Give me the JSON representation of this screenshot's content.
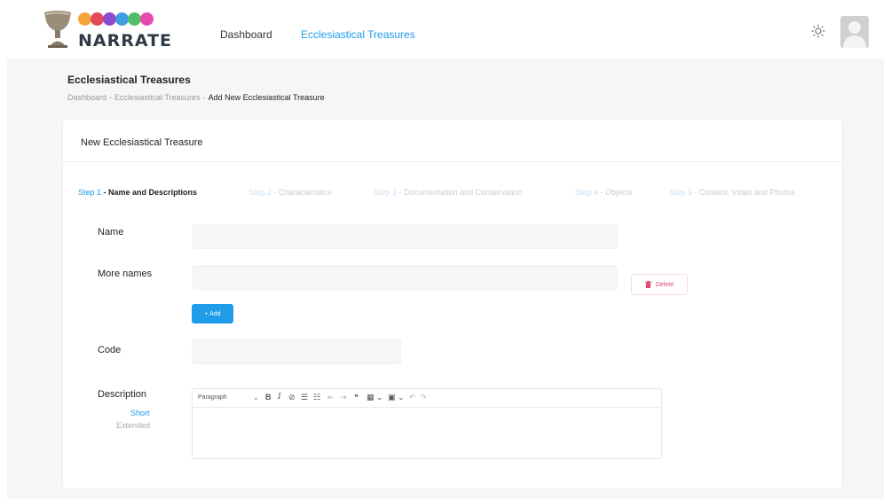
{
  "app": {
    "logo_text": "NARRATE",
    "logo_dot_colors": [
      "#f2a63a",
      "#e2495a",
      "#8b4ccf",
      "#3f9ee0",
      "#4fbf6a",
      "#e64bb0"
    ]
  },
  "nav": {
    "dashboard": "Dashboard",
    "ecclesiastical": "Ecclesiastical Treasures"
  },
  "page": {
    "title": "Ecclesiastical Treasures",
    "breadcrumb": {
      "item1": "Dashboard",
      "sep": "-",
      "item2": "Ecclesiastical Treasures",
      "current": "Add New Ecclesiastical Treasure"
    }
  },
  "card": {
    "title": "New Ecclesiastical Treasure"
  },
  "steps": [
    {
      "num": "Step 1",
      "sep": " - ",
      "label": "Name and Descriptions",
      "active": true
    },
    {
      "num": "Step 2",
      "sep": " - ",
      "label": "Characteristics",
      "active": false
    },
    {
      "num": "Step 3",
      "sep": " - ",
      "label": "Documentation and Conservation",
      "active": false
    },
    {
      "num": "Step 4",
      "sep": " - ",
      "label": "Objects",
      "active": false
    },
    {
      "num": "Step 5",
      "sep": " - ",
      "label": "Content, Video and Photos",
      "active": false
    }
  ],
  "form": {
    "name_label": "Name",
    "more_names_label": "More names",
    "delete_label": "Delete",
    "add_label": "+ Add",
    "code_label": "Code",
    "description_label": "Description",
    "short_label": "Short",
    "extended_label": "Extended"
  },
  "editor": {
    "paragraph": "Paragraph",
    "chevron": "⌄",
    "bold": "B",
    "italic": "I",
    "link": "⊘",
    "bullets": "☰",
    "numbered": "☷",
    "outdent": "⇤",
    "indent": "⇥",
    "quote": "❝",
    "table": "▦ ⌄",
    "media": "▣ ⌄",
    "undo": "↶",
    "redo": "↷"
  },
  "colors": {
    "accent": "#1e9be9",
    "danger": "#e0476f"
  }
}
